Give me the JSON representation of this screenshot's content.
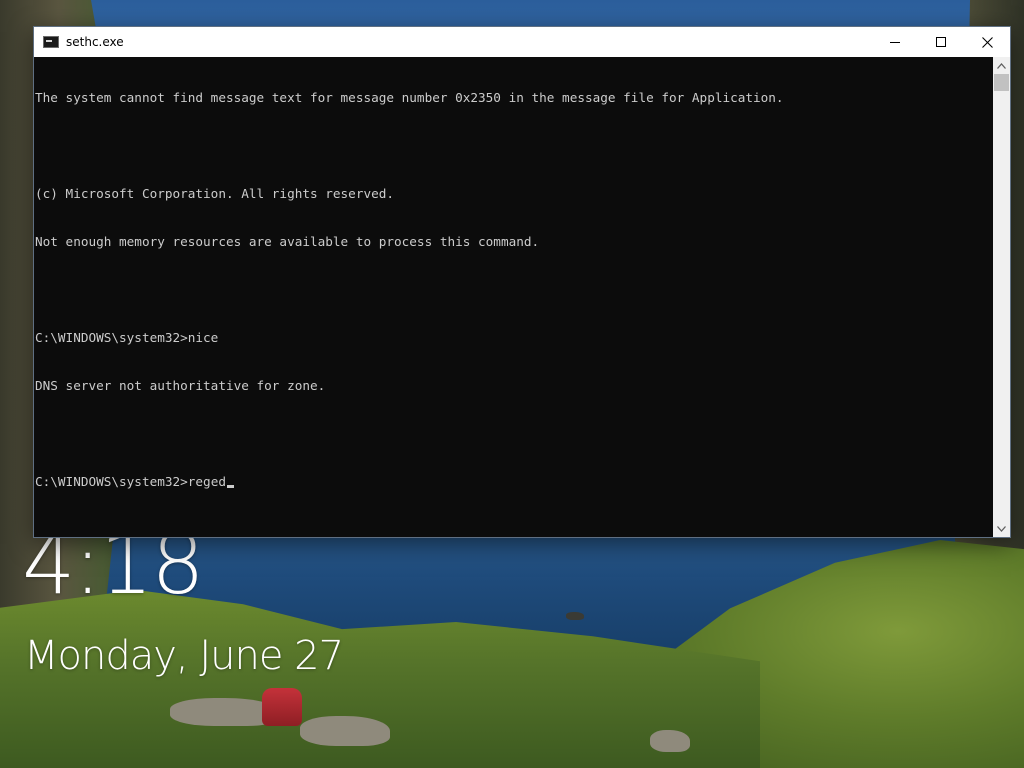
{
  "window": {
    "title": "sethc.exe",
    "console_lines": [
      "The system cannot find message text for message number 0x2350 in the message file for Application.",
      "",
      "(c) Microsoft Corporation. All rights reserved.",
      "Not enough memory resources are available to process this command.",
      "",
      "C:\\WINDOWS\\system32>nice",
      "DNS server not authoritative for zone.",
      ""
    ],
    "prompt": "C:\\WINDOWS\\system32>",
    "current_input": "reged"
  },
  "lockscreen": {
    "time": "4:18",
    "date": "Monday, June 27"
  },
  "icons": {
    "app": "console-app-icon",
    "minimize": "minimize-icon",
    "maximize": "maximize-icon",
    "close": "close-icon",
    "scroll_up": "chevron-up-icon",
    "scroll_down": "chevron-down-icon"
  },
  "colors": {
    "console_bg": "#0c0c0c",
    "console_fg": "#cccccc",
    "titlebar_bg": "#ffffff"
  }
}
